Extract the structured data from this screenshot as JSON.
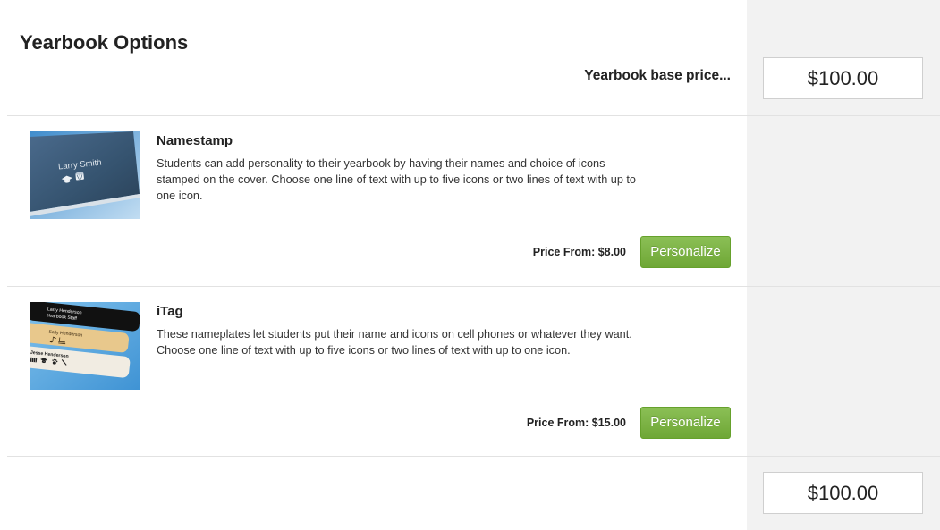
{
  "page_title": "Yearbook Options",
  "base_price": {
    "label": "Yearbook base price...",
    "value": "$100.00"
  },
  "options": [
    {
      "name": "Namestamp",
      "description": "Students can add personality to their yearbook by having their names and choice of icons stamped on the cover. Choose one line of text with up to five icons or two lines of text with up to one icon.",
      "price_prefix": "Price From:",
      "price": "$8.00",
      "button_label": "Personalize",
      "image": {
        "cover_text": "Larry Smith",
        "icons": [
          "graduation-cap-icon",
          "drum-icon"
        ]
      }
    },
    {
      "name": "iTag",
      "description": "These nameplates let students put their name and icons on cell phones or whatever they want. Choose one line of text with up to five icons or two lines of text with up to one icon.",
      "price_prefix": "Price From:",
      "price": "$15.00",
      "button_label": "Personalize",
      "image": {
        "plates": [
          {
            "lines": [
              "Larry Henderson",
              "Yearbook Staff"
            ],
            "color": "#111111",
            "icons": []
          },
          {
            "lines": [
              "Sally Henderson"
            ],
            "color": "#e8c88c",
            "icons": [
              "music-note-icon",
              "skate-icon"
            ]
          },
          {
            "lines": [
              "Jesse Henderson"
            ],
            "color": "#f1ece2",
            "icons": [
              "drum-icon",
              "graduation-cap-icon",
              "paw-icon",
              "gavel-icon"
            ]
          }
        ]
      }
    }
  ],
  "total": {
    "value": "$100.00"
  },
  "colors": {
    "button_green": "#78b53a",
    "price_column_bg": "#f2f2f2",
    "divider": "#e2e2e2"
  }
}
